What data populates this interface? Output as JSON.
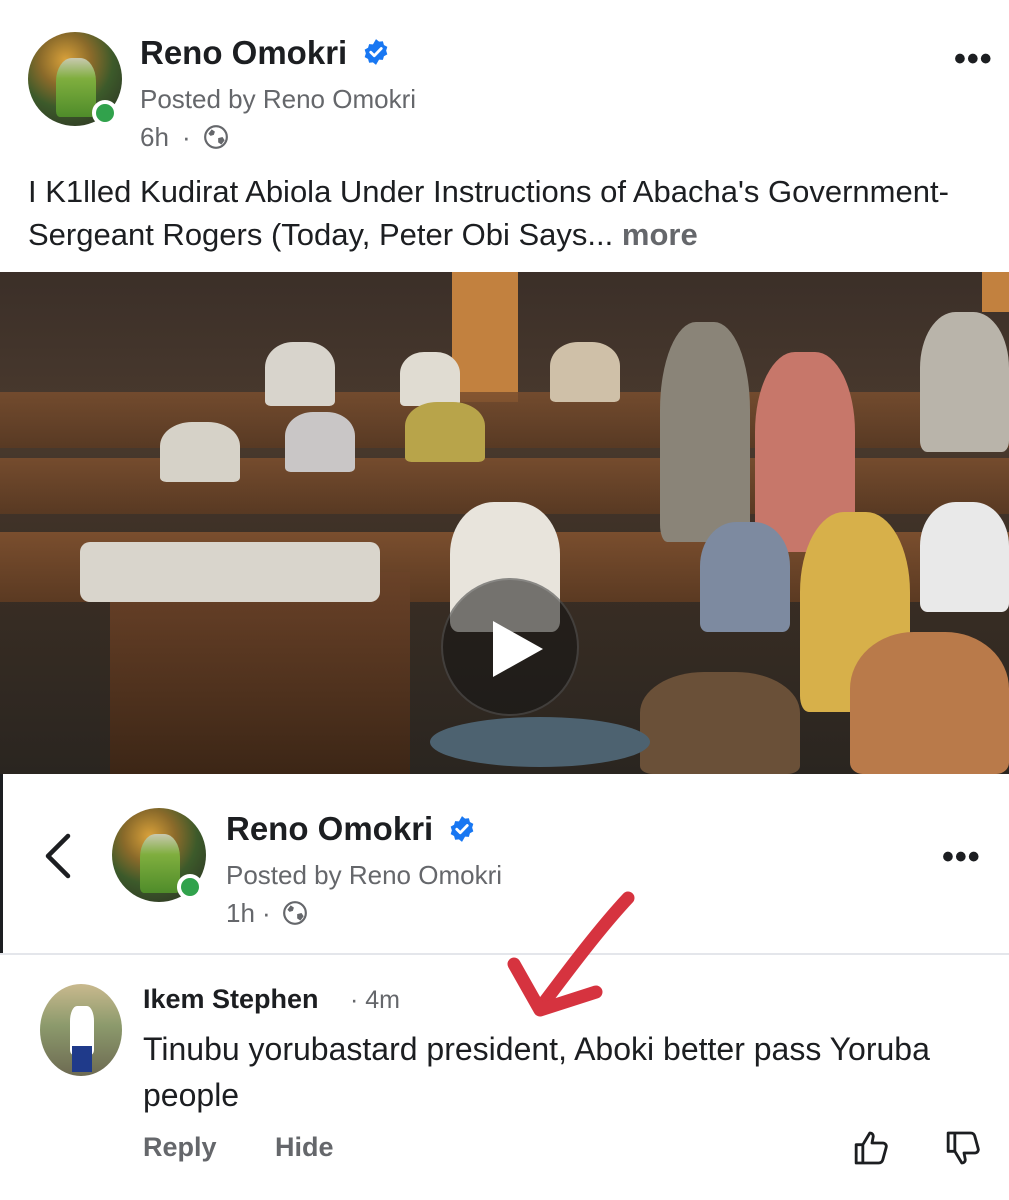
{
  "post": {
    "author": "Reno Omokri",
    "posted_by": "Posted by Reno Omokri",
    "time": "6h",
    "separator": "·",
    "text": "I K1lled Kudirat Abiola Under Instructions of Abacha's Government-Sergeant Rogers (Today, Peter Obi Says... ",
    "more_label": "more"
  },
  "overlay_post": {
    "author": "Reno Omokri",
    "posted_by": "Posted by Reno Omokri",
    "time": "1h",
    "separator": "·"
  },
  "comment": {
    "author": "Ikem Stephen",
    "time": "· 4m",
    "text": "Tinubu yorubastard president, Aboki better pass Yoruba people",
    "reply_label": "Reply",
    "hide_label": "Hide"
  },
  "icons": {
    "verified": "verified-badge-icon",
    "globe": "globe-icon",
    "more": "more-options-icon",
    "play": "play-icon",
    "back": "chevron-left-icon",
    "like": "thumbs-up-icon",
    "dislike": "thumbs-down-icon",
    "annotation": "red-arrow-annotation"
  },
  "colors": {
    "verified_blue": "#1877f2",
    "online_green": "#31a24c",
    "secondary_text": "#65676b",
    "annotation_red": "#d6333f"
  }
}
